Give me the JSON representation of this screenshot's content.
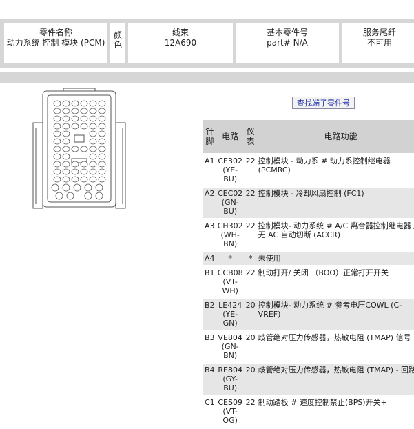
{
  "header": {
    "component_name_label": "零件名称",
    "component_name_value": "动力系统 控制 模块 (PCM)",
    "color_label": "颜色",
    "harness_label": "线束",
    "harness_value": "12A690",
    "base_part_label": "基本零件号",
    "base_part_value": "part# N/A",
    "service_suffix_label": "服务尾纤",
    "service_suffix_value": "不可用"
  },
  "find_terminal_button": "查找端子零件号",
  "table": {
    "headers": {
      "pin": "针脚",
      "circuit": "电路",
      "gauge": "仪表",
      "function": "电路功能"
    },
    "rows": [
      {
        "pin": "A1",
        "circuit": "CE302 (YE-BU)",
        "gauge": "22",
        "function": "控制模块 - 动力系 # 动力系控制继电器 (PCMRC)"
      },
      {
        "pin": "A2",
        "circuit": "CEC02 (GN-BU)",
        "gauge": "22",
        "function": "控制模块 - 冷却风扇控制 (FC1)"
      },
      {
        "pin": "A3",
        "circuit": "CH302 (WH-BN)",
        "gauge": "22",
        "function": "控制模块- 动力系统 # A/C 离合器控制继电器 / 无 AC 自动切断 (ACCR)"
      },
      {
        "pin": "A4",
        "circuit": "*",
        "gauge": "*",
        "function": "未使用"
      },
      {
        "pin": "B1",
        "circuit": "CCB08 (VT-WH)",
        "gauge": "22",
        "function": "制动打开/ 关闭 （BOO）正常打开开关"
      },
      {
        "pin": "B2",
        "circuit": "LE424 (YE-GN)",
        "gauge": "20",
        "function": "控制模块- 动力系统 # 参考电压COWL (C-VREF)"
      },
      {
        "pin": "B3",
        "circuit": "VE804 (GN-BN)",
        "gauge": "20",
        "function": "歧管绝对压力传感器，热敏电阻 (TMAP) 信号"
      },
      {
        "pin": "B4",
        "circuit": "RE804 (GY-BU)",
        "gauge": "20",
        "function": "歧管绝对压力传感器，热敏电阻 (TMAP) - 回路"
      },
      {
        "pin": "C1",
        "circuit": "CES09 (VT-OG)",
        "gauge": "22",
        "function": "制动踏板 # 速度控制禁止(BPS)开关+"
      }
    ]
  }
}
